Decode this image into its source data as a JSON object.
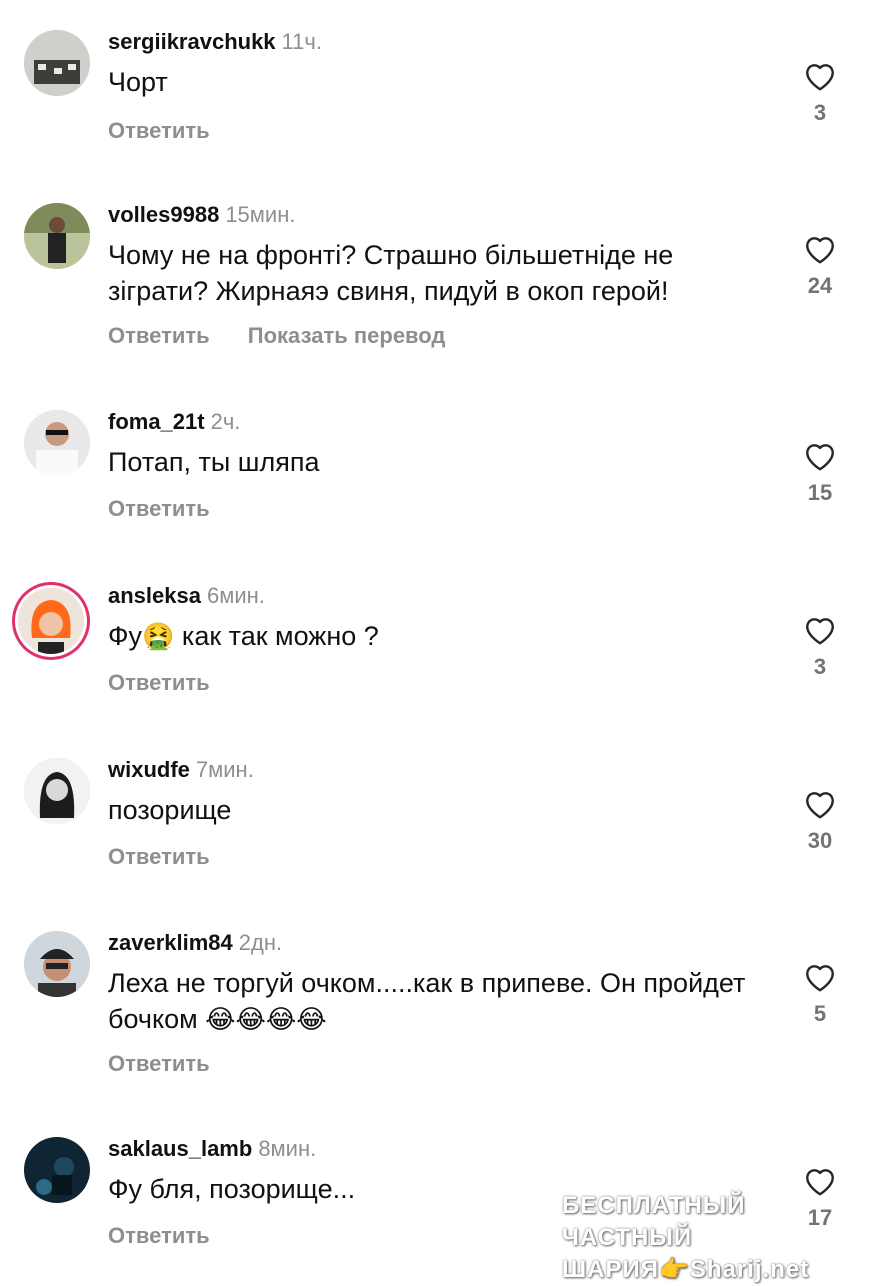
{
  "reply_label": "Ответить",
  "translate_label": "Показать перевод",
  "comments": [
    {
      "username": "sergiikravchukk",
      "time": "11ч.",
      "text": "Чорт",
      "likes": "3"
    },
    {
      "username": "volles9988",
      "time": "15мин.",
      "text": "Чому не на фронті? Страшно більшетніде не зіграти? Жирнаяэ свиня, пидуй в окоп герой!",
      "likes": "24"
    },
    {
      "username": "foma_21t",
      "time": "2ч.",
      "text": "Потап, ты шляпа",
      "likes": "15"
    },
    {
      "username": "ansleksa",
      "time": "6мин.",
      "text_before": "Фу",
      "emoji": "🤮",
      "text_after": " как так можно ?",
      "likes": "3"
    },
    {
      "username": "wixudfe",
      "time": "7мин.",
      "text": "позорище",
      "likes": "30"
    },
    {
      "username": "zaverklim84",
      "time": "2дн.",
      "text": "Леха не торгуй очком.....как в припеве.  Он пройдет бочком",
      "emojis": "😂😂😂😂",
      "likes": "5"
    },
    {
      "username": "saklaus_lamb",
      "time": "8мин.",
      "text": "Фу бля, позорище...",
      "likes": "17"
    }
  ],
  "watermark": {
    "line1": "БЕСПЛАТНЫЙ ЧАСТНЫЙ",
    "line2": "ШАРИЯ👉Sharij.net"
  },
  "icons": {
    "like": "heart-outline-icon"
  },
  "colors": {
    "secondary_text": "#8e8e8e",
    "story_ring": "#e1306c"
  }
}
